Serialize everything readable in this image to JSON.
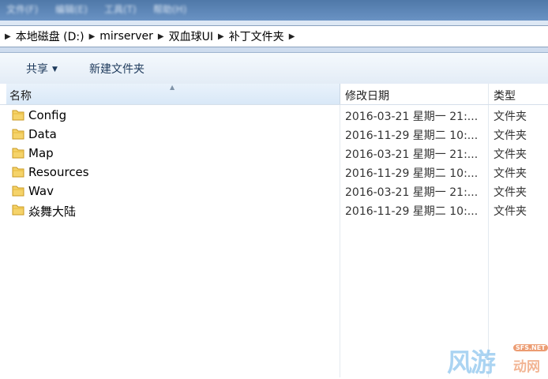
{
  "menubar": {
    "items": [
      "文件(F)",
      "编辑(E)",
      "工具(T)",
      "帮助(H)"
    ]
  },
  "breadcrumb": {
    "items": [
      "本地磁盘 (D:)",
      "mirserver",
      "双血球UI",
      "补丁文件夹"
    ]
  },
  "toolbar": {
    "share_label": "共享",
    "new_folder_label": "新建文件夹"
  },
  "columns": {
    "name": "名称",
    "date": "修改日期",
    "type": "类型"
  },
  "files": [
    {
      "name": "Config",
      "date": "2016-03-21 星期一 21:...",
      "type": "文件夹"
    },
    {
      "name": "Data",
      "date": "2016-11-29 星期二 10:...",
      "type": "文件夹"
    },
    {
      "name": "Map",
      "date": "2016-03-21 星期一 21:...",
      "type": "文件夹"
    },
    {
      "name": "Resources",
      "date": "2016-11-29 星期二 10:...",
      "type": "文件夹"
    },
    {
      "name": "Wav",
      "date": "2016-03-21 星期一 21:...",
      "type": "文件夹"
    },
    {
      "name": "焱舞大陆",
      "date": "2016-11-29 星期二 10:...",
      "type": "文件夹"
    }
  ],
  "icons": {
    "folder": "folder-icon",
    "crumb_separator": "chevron-right-icon",
    "sort": "sort-ascending-icon"
  },
  "colors": {
    "folder_light": "#f7d774",
    "folder_dark": "#d9a92b",
    "header_selected": "#dbe9f7"
  },
  "watermark": {
    "main": "风游",
    "sub": "动网",
    "domain": "SFS.NET"
  }
}
